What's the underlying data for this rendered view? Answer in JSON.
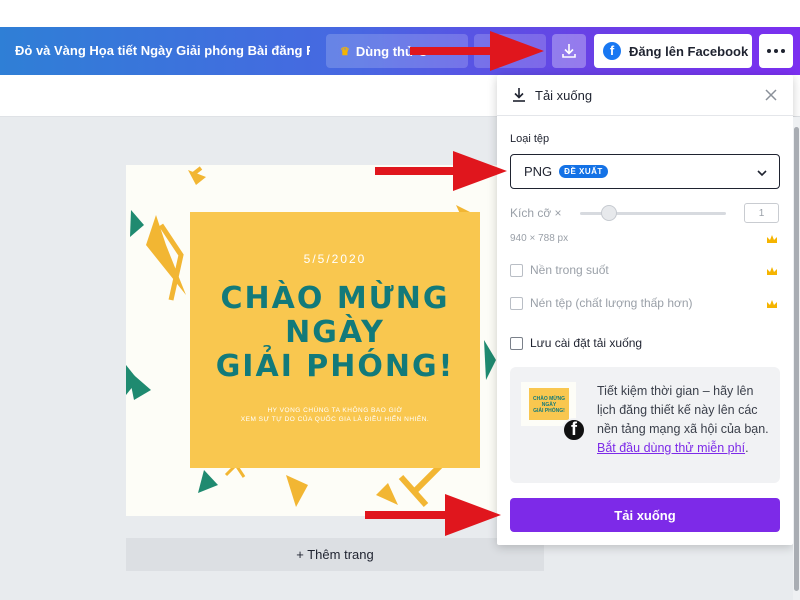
{
  "header": {
    "doc_title": "Đỏ và Vàng Họa tiết Ngày Giải phóng Bài đăng F...",
    "trial_label": "Dùng thử C",
    "facebook_label": "Đăng lên Facebook"
  },
  "canvas": {
    "date": "5/5/2020",
    "headline_lines": [
      "CHÀO MỪNG",
      "NGÀY",
      "GIẢI PHÓNG!"
    ],
    "subtext_lines": [
      "HY VỌNG CHÚNG TA KHÔNG BAO GIỜ",
      "XEM SỰ TỰ DO CỦA QUỐC GIA LÀ ĐIỀU HIỂN NHIÊN."
    ],
    "add_page_label": "+ Thêm trang"
  },
  "panel": {
    "title": "Tải xuống",
    "file_type_label": "Loại tệp",
    "file_type_value": "PNG",
    "recommended_badge": "ĐỀ XUẤT",
    "size_label": "Kích cỡ ×",
    "size_value": "1",
    "dimensions": "940 × 788 px",
    "opt_transparent": "Nền trong suốt",
    "opt_compress": "Nén tệp (chất lượng thấp hơn)",
    "opt_save_settings": "Lưu cài đặt tải xuống",
    "promo_text": "Tiết kiệm thời gian – hãy lên lịch đăng thiết kế này lên các nền tảng mạng xã hội của bạn.",
    "promo_link": "Bắt đầu dùng thử miễn phí",
    "promo_end": ".",
    "promo_thumb_text": [
      "CHÀO MỪNG",
      "NGÀY",
      "GIẢI PHÓNG!"
    ],
    "download_button": "Tải xuống"
  },
  "icons": {
    "crown": "crown-icon",
    "download": "download-icon",
    "close": "close-icon",
    "chevron": "chevron-down-icon",
    "facebook": "facebook-icon",
    "more": "more-icon"
  },
  "colors": {
    "header_start": "#2f7fd6",
    "header_end": "#7b2ff0",
    "primary_purple": "#7d2ae8",
    "canvas_yellow": "#f9c74f",
    "canvas_teal": "#127a7a",
    "badge_blue": "#1472e6",
    "arrow_red": "#e0161d"
  }
}
